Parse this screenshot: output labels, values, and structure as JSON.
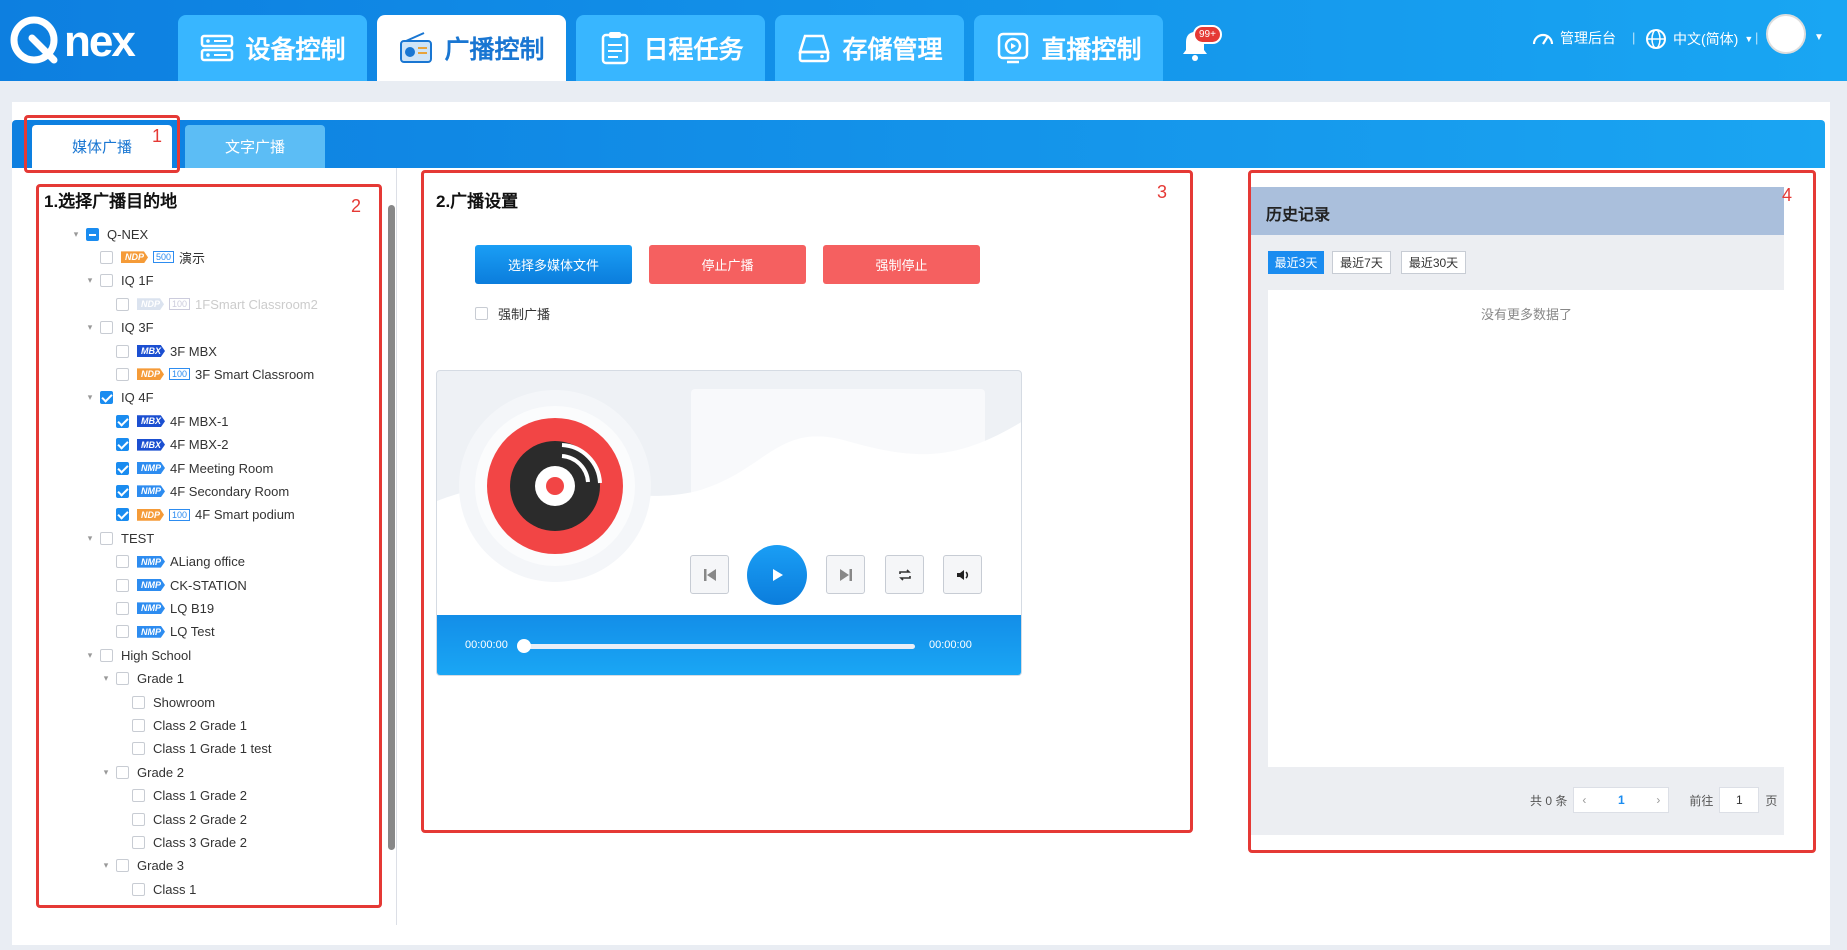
{
  "logo": {
    "text": "Q.nex"
  },
  "nav": {
    "tabs": [
      {
        "label": "设备控制",
        "icon": "device-server-icon"
      },
      {
        "label": "广播控制",
        "icon": "radio-icon",
        "active": true
      },
      {
        "label": "日程任务",
        "icon": "clipboard-icon"
      },
      {
        "label": "存储管理",
        "icon": "storage-drive-icon"
      },
      {
        "label": "直播控制",
        "icon": "live-camera-icon"
      }
    ],
    "notifications_badge": "99+",
    "admin_label": "管理后台",
    "language_label": "中文(简体)"
  },
  "subtabs": {
    "media": "媒体广播",
    "text": "文字广播"
  },
  "annotations": [
    "1",
    "2",
    "3",
    "4"
  ],
  "destination": {
    "title": "1.选择广播目的地",
    "tree": [
      {
        "label": "Q-NEX",
        "level": 0,
        "state": "half",
        "caret": true
      },
      {
        "label": "演示",
        "level": 1,
        "tag": "NDP",
        "tagType": "ndp",
        "cap": "500"
      },
      {
        "label": "IQ 1F",
        "level": 1,
        "caret": true
      },
      {
        "label": "1FSmart Classroom2",
        "level": 2,
        "tag": "NDP",
        "tagType": "dis",
        "cap": "100",
        "disabled": true
      },
      {
        "label": "IQ 3F",
        "level": 1,
        "caret": true
      },
      {
        "label": "3F MBX",
        "level": 2,
        "tag": "MBX",
        "tagType": "mbx"
      },
      {
        "label": "3F Smart Classroom",
        "level": 2,
        "tag": "NDP",
        "tagType": "ndp",
        "cap": "100"
      },
      {
        "label": "IQ 4F",
        "level": 1,
        "caret": true,
        "state": "checked"
      },
      {
        "label": "4F MBX-1",
        "level": 2,
        "tag": "MBX",
        "tagType": "mbx",
        "state": "checked"
      },
      {
        "label": "4F MBX-2",
        "level": 2,
        "tag": "MBX",
        "tagType": "mbx",
        "state": "checked"
      },
      {
        "label": "4F Meeting Room",
        "level": 2,
        "tag": "NMP",
        "tagType": "nmp",
        "state": "checked"
      },
      {
        "label": "4F Secondary Room",
        "level": 2,
        "tag": "NMP",
        "tagType": "nmp",
        "state": "checked"
      },
      {
        "label": "4F Smart podium",
        "level": 2,
        "tag": "NDP",
        "tagType": "ndp",
        "cap": "100",
        "state": "checked"
      },
      {
        "label": "TEST",
        "level": 1,
        "caret": true
      },
      {
        "label": "ALiang office",
        "level": 2,
        "tag": "NMP",
        "tagType": "nmp"
      },
      {
        "label": "CK-STATION",
        "level": 2,
        "tag": "NMP",
        "tagType": "nmp"
      },
      {
        "label": "LQ B19",
        "level": 2,
        "tag": "NMP",
        "tagType": "nmp"
      },
      {
        "label": "LQ Test",
        "level": 2,
        "tag": "NMP",
        "tagType": "nmp"
      },
      {
        "label": "High School",
        "level": 1,
        "caret": true
      },
      {
        "label": "Grade 1",
        "level": 2,
        "caret": true
      },
      {
        "label": "Showroom",
        "level": 3
      },
      {
        "label": "Class 2 Grade 1",
        "level": 3
      },
      {
        "label": "Class 1 Grade 1 test",
        "level": 3
      },
      {
        "label": "Grade 2",
        "level": 2,
        "caret": true
      },
      {
        "label": "Class 1 Grade 2",
        "level": 3
      },
      {
        "label": "Class 2 Grade 2",
        "level": 3
      },
      {
        "label": "Class 3 Grade 2",
        "level": 3
      },
      {
        "label": "Grade 3",
        "level": 2,
        "caret": true
      },
      {
        "label": "Class 1",
        "level": 3
      }
    ]
  },
  "settings": {
    "title": "2.广播设置",
    "select_media": "选择多媒体文件",
    "stop": "停止广播",
    "force_stop": "强制停止",
    "force_broadcast": "强制广播",
    "time_current": "00:00:00",
    "time_total": "00:00:00",
    "progress": 0
  },
  "history": {
    "title": "历史记录",
    "ranges": [
      "最近3天",
      "最近7天",
      "最近30天"
    ],
    "active_range": 0,
    "empty_text": "没有更多数据了",
    "total_text": "共 0 条",
    "page": "1",
    "goto_label": "前往",
    "goto_value": "1",
    "page_suffix": "页"
  },
  "colors": {
    "primary": "#1a8cf0",
    "danger": "#f56060",
    "annotation": "#e53935"
  }
}
